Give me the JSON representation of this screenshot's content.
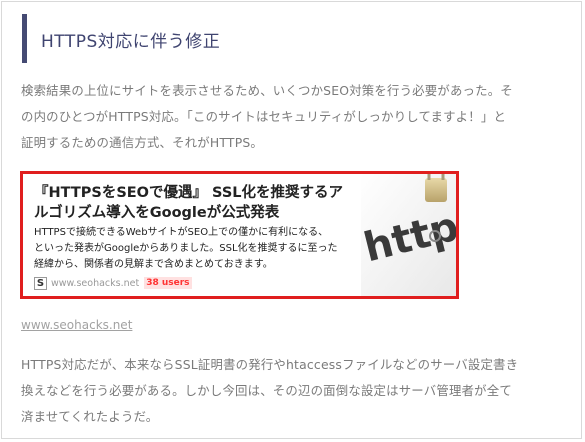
{
  "heading": "HTTPS対応に伴う修正",
  "intro_lines": [
    "検索結果の上位にサイトを表示させるため、いくつかSEO対策を行う必要があった。そ",
    "の内のひとつがHTTPS対応。「このサイトはセキュリティがしっかりしてますよ！」と",
    "証明するための通信方式、それがHTTPS。"
  ],
  "card": {
    "title_lines": [
      "『HTTPSをSEOで優遇』 SSL化を推奨するア",
      "ルゴリズム導入をGoogleが公式発表"
    ],
    "desc_lines": [
      "HTTPSで接続できるWebサイトがSEO上での僅かに有利になる、",
      "といった発表がGoogleからありました。SSL化を推奨するに至った",
      "経緯から、関係者の見解まで含めまとめておきます。"
    ],
    "favicon_letter": "S",
    "domain": "www.seohacks.net",
    "users": "38 users",
    "image_text": "https",
    "border_color": "#e01e1e"
  },
  "link_text": "www.seohacks.net",
  "body_lines": [
    "HTTPS対応だが、本来ならSSL証明書の発行やhtaccessファイルなどのサーバ設定書き",
    "換えなどを行う必要がある。しかし今回は、その辺の面倒な設定はサーバ管理者が全て",
    "済ませてくれたようだ。"
  ]
}
